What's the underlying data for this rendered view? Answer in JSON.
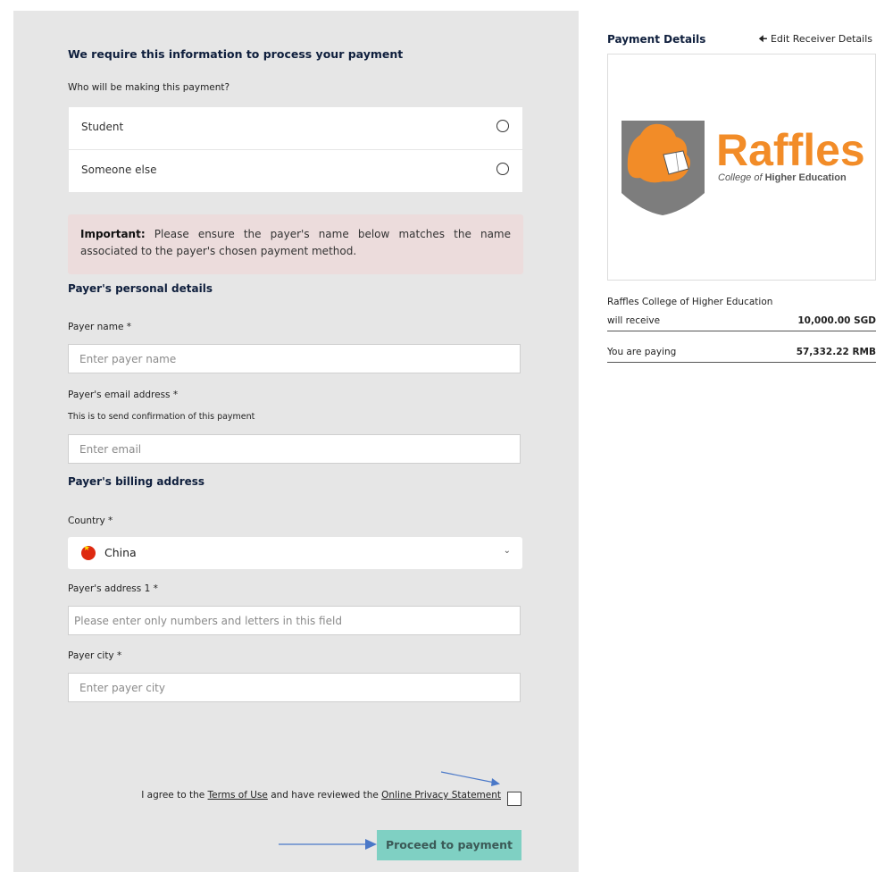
{
  "form": {
    "title": "We require this information to process your payment",
    "payer_question": "Who will be making this payment?",
    "payer_options": [
      "Student",
      "Someone else"
    ],
    "notice": {
      "bold": "Important:",
      "text": " Please ensure the payer's name below matches the name associated to the payer's chosen payment method."
    },
    "personal_section": "Payer's personal details",
    "payer_name_label": "Payer name *",
    "payer_name_placeholder": "Enter payer name",
    "email_label": "Payer's email address *",
    "email_help": "This is to send confirmation of this payment",
    "email_placeholder": "Enter email",
    "billing_section": "Payer's billing address",
    "country_label": "Country *",
    "country_value": "China",
    "address1_label": "Payer's address 1 *",
    "address1_placeholder": "Please enter only numbers and letters in this field",
    "city_label": "Payer city *",
    "city_placeholder": "Enter payer city",
    "agree": {
      "prefix": "I agree to the ",
      "terms": "Terms of Use",
      "middle": " and have reviewed the ",
      "privacy": "Online Privacy Statement"
    },
    "submit_label": "Proceed to payment"
  },
  "details": {
    "title": "Payment Details",
    "edit_label": "Edit Receiver Details",
    "logo": {
      "name": "Raffles",
      "tagline_italic": "College of",
      "tagline_rest": " Higher Education"
    },
    "receiver_name": "Raffles College of Higher Education",
    "receive_label": "will receive",
    "receive_amount": "10,000.00 SGD",
    "paying_label": "You are paying",
    "paying_amount": "57,332.22 RMB"
  },
  "colors": {
    "panel_bg": "#e6e6e6",
    "notice_bg": "#ecdcdc",
    "button_bg": "#7fd0c3",
    "brand_orange": "#f28c28",
    "arrow_blue": "#4a78c8",
    "heading_navy": "#0f1f3d"
  },
  "icons": [
    "radio-icon",
    "china-flag-icon",
    "chevron-down-icon",
    "arrow-left-icon",
    "checkbox-icon"
  ]
}
